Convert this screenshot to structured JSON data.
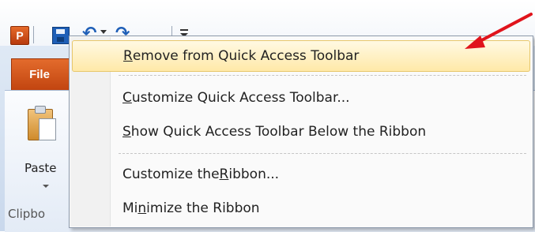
{
  "app": {
    "logo_letter": "P",
    "file_tab_label": "File"
  },
  "quick_access_toolbar": {
    "items": [
      "save-icon",
      "undo-icon",
      "undo-dropdown",
      "redo-icon",
      "customize-quick-access-toolbar-icon"
    ]
  },
  "ribbon": {
    "paste_label": "Paste",
    "clipboard_group_label": "Clipbo"
  },
  "context_menu": {
    "items": [
      {
        "pre": "",
        "ul": "R",
        "post": "emove from Quick Access Toolbar",
        "highlighted": true
      },
      {
        "pre": "",
        "ul": "C",
        "post": "ustomize Quick Access Toolbar...",
        "highlighted": false
      },
      {
        "pre": "",
        "ul": "S",
        "post": "how Quick Access Toolbar Below the Ribbon",
        "highlighted": false
      },
      {
        "pre": "Customize the ",
        "ul": "R",
        "post": "ibbon...",
        "highlighted": false
      },
      {
        "pre": "Mi",
        "ul": "n",
        "post": "imize the Ribbon",
        "highlighted": false
      }
    ]
  },
  "colors": {
    "file_tab": "#d04f14",
    "menu_highlight": "#ffe9a8",
    "annotation_arrow": "#e0141c"
  }
}
